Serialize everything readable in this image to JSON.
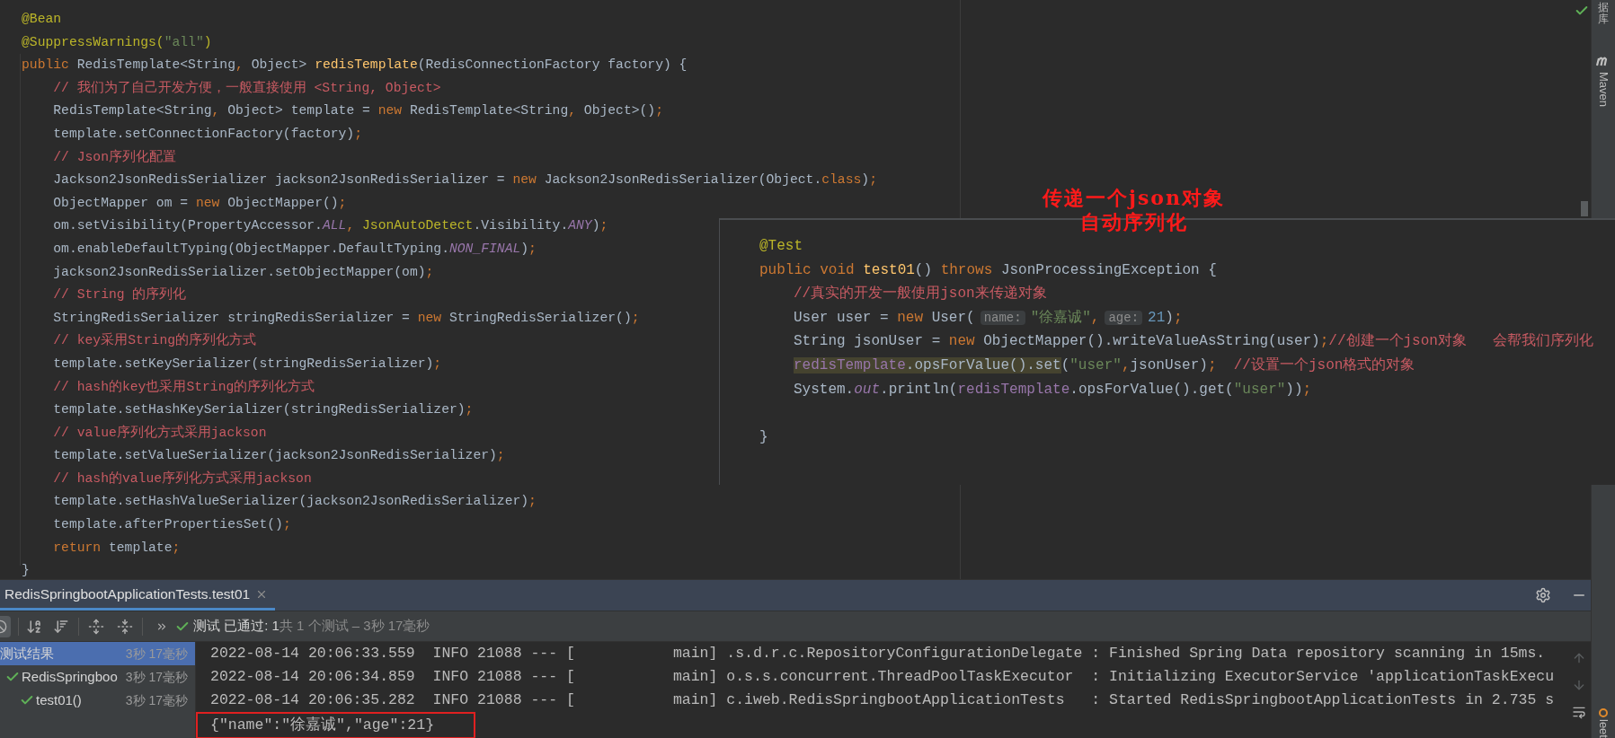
{
  "editor": {
    "lines": [
      [
        {
          "text": "@Bean",
          "kind": "annotation"
        }
      ],
      [
        {
          "text": "@SuppressWarnings(",
          "kind": "annotation"
        },
        {
          "text": "\"all\"",
          "kind": "string"
        },
        {
          "text": ")",
          "kind": "annotation"
        }
      ],
      [
        {
          "text": "public ",
          "kind": "keyword"
        },
        {
          "text": "RedisTemplate<String",
          "kind": "plain"
        },
        {
          "text": ", ",
          "kind": "punct"
        },
        {
          "text": "Object> ",
          "kind": "plain"
        },
        {
          "text": "redisTemplate",
          "kind": "method"
        },
        {
          "text": "(RedisConnectionFactory factory) {",
          "kind": "plain"
        }
      ],
      [
        {
          "text": "    // 我们为了自己开发方便，一般直接使用 <String, Object>",
          "kind": "comment"
        }
      ],
      [
        {
          "text": "    RedisTemplate<String",
          "kind": "plain"
        },
        {
          "text": ", ",
          "kind": "punct"
        },
        {
          "text": "Object> template = ",
          "kind": "plain"
        },
        {
          "text": "new ",
          "kind": "keyword"
        },
        {
          "text": "RedisTemplate<String",
          "kind": "plain"
        },
        {
          "text": ", ",
          "kind": "punct"
        },
        {
          "text": "Object>()",
          "kind": "plain"
        },
        {
          "text": ";",
          "kind": "punct"
        }
      ],
      [
        {
          "text": "    template.setConnectionFactory(factory)",
          "kind": "plain"
        },
        {
          "text": ";",
          "kind": "punct"
        }
      ],
      [
        {
          "text": "    // Json序列化配置",
          "kind": "comment"
        }
      ],
      [
        {
          "text": "    Jackson2JsonRedisSerializer jackson2JsonRedisSerializer = ",
          "kind": "plain"
        },
        {
          "text": "new ",
          "kind": "keyword"
        },
        {
          "text": "Jackson2JsonRedisSerializer(Object.",
          "kind": "plain"
        },
        {
          "text": "class",
          "kind": "keyword"
        },
        {
          "text": ")",
          "kind": "plain"
        },
        {
          "text": ";",
          "kind": "punct"
        }
      ],
      [
        {
          "text": "    ObjectMapper om = ",
          "kind": "plain"
        },
        {
          "text": "new ",
          "kind": "keyword"
        },
        {
          "text": "ObjectMapper()",
          "kind": "plain"
        },
        {
          "text": ";",
          "kind": "punct"
        }
      ],
      [
        {
          "text": "    om.setVisibility(PropertyAccessor.",
          "kind": "plain"
        },
        {
          "text": "ALL",
          "kind": "constant"
        },
        {
          "text": ", ",
          "kind": "punct"
        },
        {
          "text": "JsonAutoDetect",
          "kind": "annotation"
        },
        {
          "text": ".Visibility.",
          "kind": "plain"
        },
        {
          "text": "ANY",
          "kind": "constant"
        },
        {
          "text": ")",
          "kind": "plain"
        },
        {
          "text": ";",
          "kind": "punct"
        }
      ],
      [
        {
          "text": "    om.enableDefaultTyping(ObjectMapper.DefaultTyping.",
          "kind": "plain"
        },
        {
          "text": "NON_FINAL",
          "kind": "constant"
        },
        {
          "text": ")",
          "kind": "plain"
        },
        {
          "text": ";",
          "kind": "punct"
        }
      ],
      [
        {
          "text": "    jackson2JsonRedisSerializer.setObjectMapper(om)",
          "kind": "plain"
        },
        {
          "text": ";",
          "kind": "punct"
        }
      ],
      [
        {
          "text": "    // String 的序列化",
          "kind": "comment"
        }
      ],
      [
        {
          "text": "    StringRedisSerializer stringRedisSerializer = ",
          "kind": "plain"
        },
        {
          "text": "new ",
          "kind": "keyword"
        },
        {
          "text": "StringRedisSerializer()",
          "kind": "plain"
        },
        {
          "text": ";",
          "kind": "punct"
        }
      ],
      [
        {
          "text": "    // key采用String的序列化方式",
          "kind": "comment"
        }
      ],
      [
        {
          "text": "    template.setKeySerializer(stringRedisSerializer)",
          "kind": "plain"
        },
        {
          "text": ";",
          "kind": "punct"
        }
      ],
      [
        {
          "text": "    // hash的key也采用String的序列化方式",
          "kind": "comment"
        }
      ],
      [
        {
          "text": "    template.setHashKeySerializer(stringRedisSerializer)",
          "kind": "plain"
        },
        {
          "text": ";",
          "kind": "punct"
        }
      ],
      [
        {
          "text": "    // value序列化方式采用jackson",
          "kind": "comment"
        }
      ],
      [
        {
          "text": "    template.setValueSerializer(jackson2JsonRedisSerializer)",
          "kind": "plain"
        },
        {
          "text": ";",
          "kind": "punct"
        }
      ],
      [
        {
          "text": "    // hash的value序列化方式采用jackson",
          "kind": "comment"
        }
      ],
      [
        {
          "text": "    template.setHashValueSerializer(jackson2JsonRedisSerializer)",
          "kind": "plain"
        },
        {
          "text": ";",
          "kind": "punct"
        }
      ],
      [
        {
          "text": "    template.afterPropertiesSet()",
          "kind": "plain"
        },
        {
          "text": ";",
          "kind": "punct"
        }
      ],
      [
        {
          "text": "    return ",
          "kind": "keyword"
        },
        {
          "text": "template",
          "kind": "plain"
        },
        {
          "text": ";",
          "kind": "punct"
        }
      ],
      [
        {
          "text": "}",
          "kind": "plain"
        }
      ]
    ]
  },
  "annotation": {
    "lines": [
      "传递一个json对象",
      "自动序列化"
    ]
  },
  "popup": {
    "lines": [
      {
        "kind": "code",
        "tokens": [
          {
            "text": "@Test",
            "kind": "annotation"
          }
        ]
      },
      {
        "kind": "code",
        "tokens": [
          {
            "text": "public ",
            "kind": "keyword"
          },
          {
            "text": "void ",
            "kind": "keyword"
          },
          {
            "text": "test01",
            "kind": "method"
          },
          {
            "text": "() ",
            "kind": "plain"
          },
          {
            "text": "throws ",
            "kind": "keyword"
          },
          {
            "text": "JsonProcessingException {",
            "kind": "plain"
          }
        ],
        "children": [
          {
            "kind": "code",
            "tokens": [
              {
                "text": "//真实的开发一般使用json来传递对象",
                "kind": "comment"
              }
            ]
          },
          {
            "kind": "code",
            "tokens": [
              {
                "text": "User user = ",
                "kind": "plain"
              },
              {
                "text": "new ",
                "kind": "keyword"
              },
              {
                "text": "User(",
                "kind": "plain"
              },
              {
                "text": "name:",
                "kind": "hint"
              },
              {
                "text": "\"徐嘉诚\"",
                "kind": "string"
              },
              {
                "text": ",",
                "kind": "punct"
              },
              {
                "text": "age:",
                "kind": "hint"
              },
              {
                "text": "21",
                "kind": "number"
              },
              {
                "text": ")",
                "kind": "plain"
              },
              {
                "text": ";",
                "kind": "punct"
              }
            ]
          },
          {
            "kind": "code",
            "tokens": [
              {
                "text": "String jsonUser = ",
                "kind": "plain"
              },
              {
                "text": "new ",
                "kind": "keyword"
              },
              {
                "text": "ObjectMapper().writeValueAsString(user)",
                "kind": "plain"
              },
              {
                "text": ";",
                "kind": "punct"
              },
              {
                "text": "//创建一个json对象   会帮我们序列化",
                "kind": "comment"
              }
            ]
          },
          {
            "kind": "code",
            "tokens": [
              {
                "text": "redisTemplate",
                "kind": "field",
                "highlighted": true
              },
              {
                "text": ".opsForValue().set",
                "kind": "plain",
                "highlighted": true
              },
              {
                "text": "(",
                "kind": "plain"
              },
              {
                "text": "\"user\"",
                "kind": "string"
              },
              {
                "text": ",",
                "kind": "punct"
              },
              {
                "text": "jsonUser)",
                "kind": "plain"
              },
              {
                "text": ";",
                "kind": "punct"
              },
              {
                "text": "  //设置一个json格式的对象",
                "kind": "comment"
              }
            ]
          },
          {
            "kind": "code",
            "tokens": [
              {
                "text": "System.",
                "kind": "plain"
              },
              {
                "text": "out",
                "kind": "constant"
              },
              {
                "text": ".println(",
                "kind": "plain"
              },
              {
                "text": "redisTemplate",
                "kind": "field"
              },
              {
                "text": ".opsForValue().get(",
                "kind": "plain"
              },
              {
                "text": "\"user\"",
                "kind": "string"
              },
              {
                "text": "))",
                "kind": "plain"
              },
              {
                "text": ";",
                "kind": "punct"
              }
            ]
          },
          {
            "kind": "blank"
          }
        ]
      },
      {
        "kind": "code",
        "tokens": [
          {
            "text": "}",
            "kind": "plain"
          }
        ]
      }
    ]
  },
  "right_sidebar": {
    "top_label": "据库",
    "items": [
      "Maven"
    ],
    "bottom_label": "leet"
  },
  "run_panel": {
    "tab": {
      "label": "RedisSpringbootApplicationTests.test01",
      "selected": true
    },
    "status": {
      "passed": true,
      "label": "测试 已通过: 1",
      "summary": "共 1 个测试 – 3秒 17毫秒"
    },
    "tree": [
      {
        "label": "测试结果",
        "time": "3秒 17毫秒",
        "selected": true,
        "passed": false,
        "children": [
          {
            "label": "RedisSpringboo",
            "time": "3秒 17毫秒",
            "selected": false,
            "passed": true,
            "children": [
              {
                "label": "test01()",
                "time": "3秒 17毫秒",
                "selected": false,
                "passed": true
              }
            ]
          }
        ]
      }
    ],
    "console": {
      "lines": [
        "2022-08-14 20:06:33.559  INFO 21088 --- [           main] .s.d.r.c.RepositoryConfigurationDelegate : Finished Spring Data repository scanning in 15ms.",
        "2022-08-14 20:06:34.859  INFO 21088 --- [           main] o.s.s.concurrent.ThreadPoolTaskExecutor  : Initializing ExecutorService 'applicationTaskExecu",
        "2022-08-14 20:06:35.282  INFO 21088 --- [           main] c.iweb.RedisSpringbootApplicationTests   : Started RedisSpringbootApplicationTests in 2.735 s"
      ],
      "output": "{\"name\":\"徐嘉诚\",\"age\":21}",
      "output_highlighted": true
    }
  }
}
